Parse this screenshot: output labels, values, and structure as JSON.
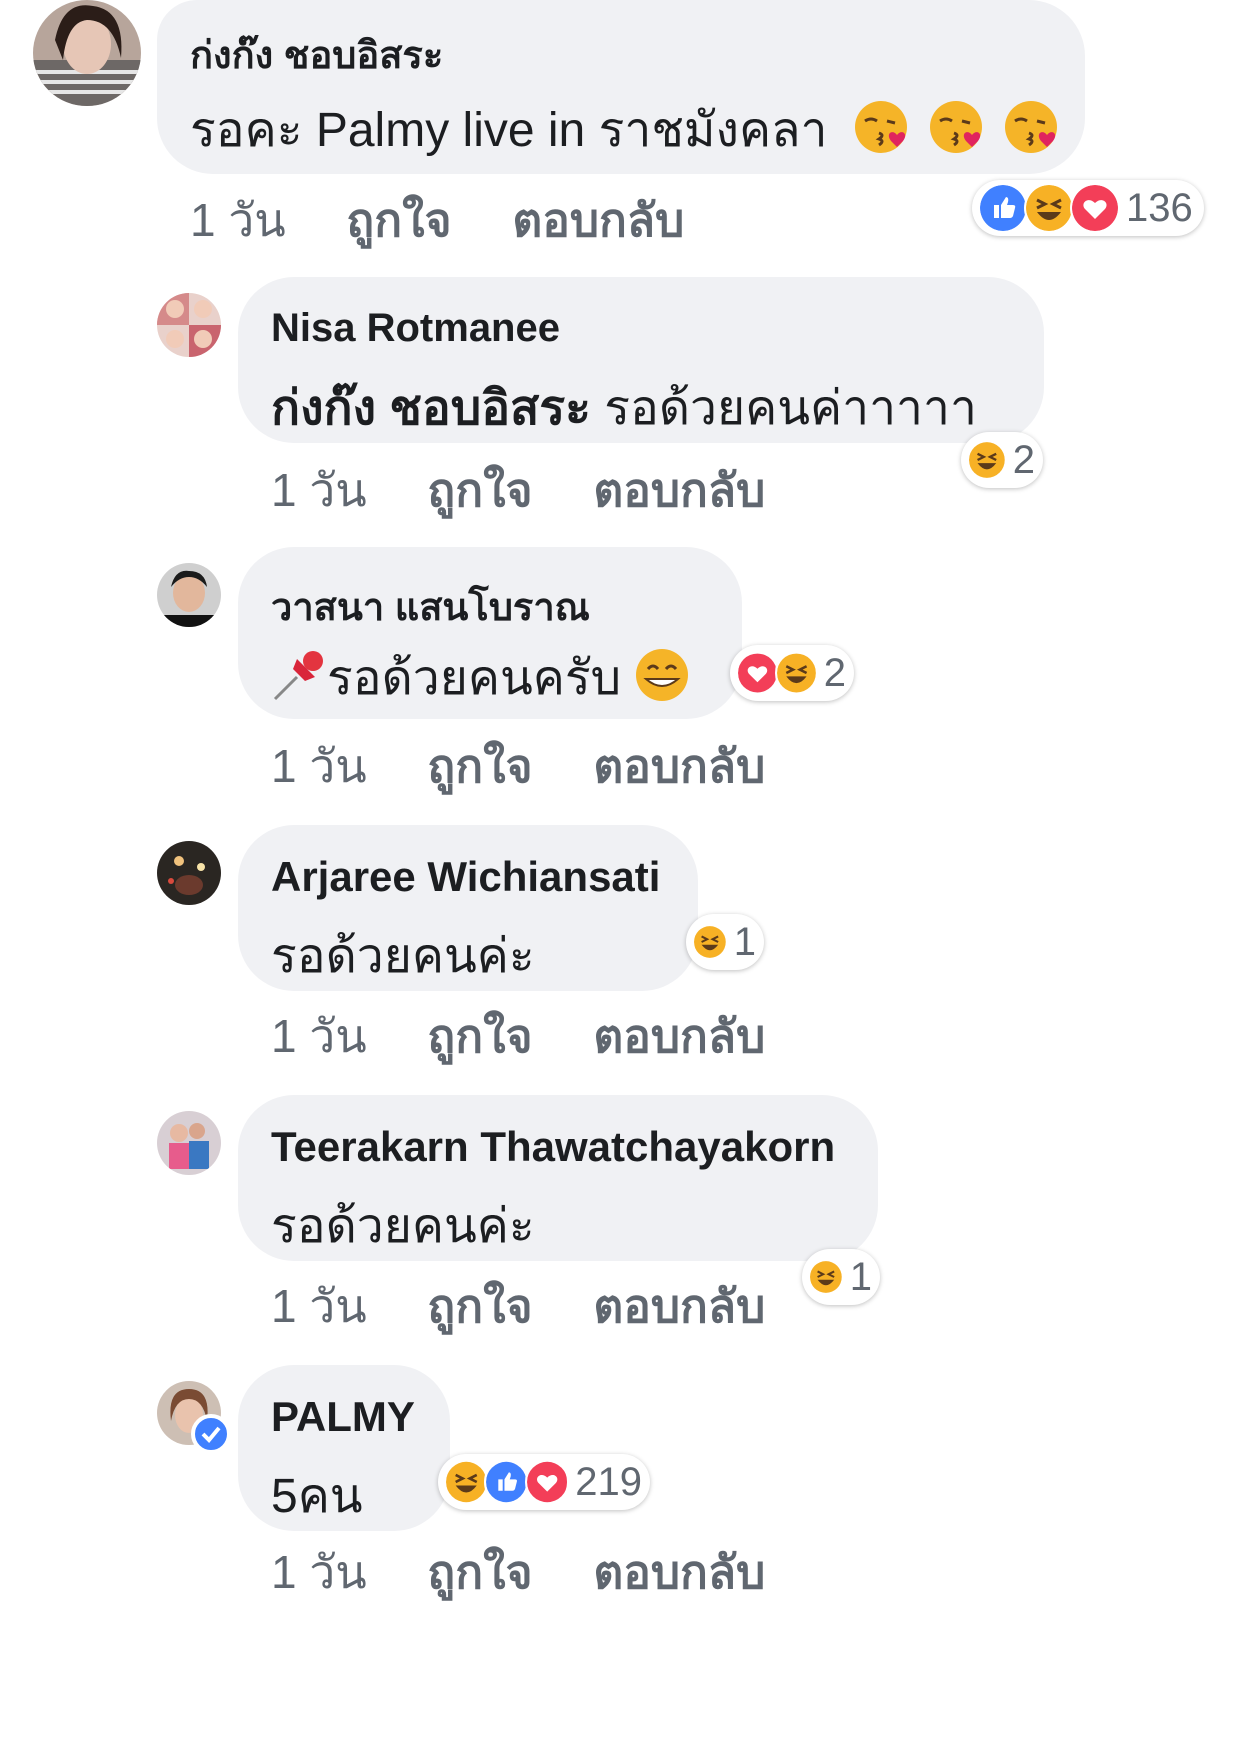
{
  "comments": [
    {
      "author": "ก่งก๊ง ชอบอิสระ",
      "text": "รอคะ Palmy live in ราชมังคลา",
      "emoji_after_text": [
        "kissing-heart",
        "kissing-heart",
        "kissing-heart"
      ],
      "time": "1 วัน",
      "like": "ถูกใจ",
      "reply": "ตอบกลับ",
      "reactions": [
        "like",
        "haha",
        "love"
      ],
      "reaction_count": "136"
    },
    {
      "author": "Nisa Rotmanee",
      "mention": "ก่งก๊ง ชอบอิสระ",
      "text": " รอด้วยคนค่าาาาา",
      "time": "1 วัน",
      "like": "ถูกใจ",
      "reply": "ตอบกลับ",
      "reactions": [
        "haha"
      ],
      "reaction_count": "2"
    },
    {
      "author": "วาสนา แสนโบราณ",
      "emoji_before_text": "pushpin",
      "text": "รอด้วยคนครับ",
      "emoji_after_text": [
        "grinning-face"
      ],
      "time": "1 วัน",
      "like": "ถูกใจ",
      "reply": "ตอบกลับ",
      "reactions": [
        "love",
        "haha"
      ],
      "reaction_count": "2"
    },
    {
      "author": "Arjaree Wichiansati",
      "text": "รอด้วยคนค่ะ",
      "time": "1 วัน",
      "like": "ถูกใจ",
      "reply": "ตอบกลับ",
      "reactions": [
        "haha"
      ],
      "reaction_count": "1"
    },
    {
      "author": "Teerakarn Thawatchayakorn",
      "text": "รอด้วยคนค่ะ",
      "time": "1 วัน",
      "like": "ถูกใจ",
      "reply": "ตอบกลับ",
      "reactions": [
        "haha"
      ],
      "reaction_count": "1"
    },
    {
      "author": "PALMY",
      "verified": true,
      "text": "5คน",
      "time": "1 วัน",
      "like": "ถูกใจ",
      "reply": "ตอบกลับ",
      "reactions": [
        "haha",
        "like",
        "love"
      ],
      "reaction_count": "219"
    }
  ],
  "colors": {
    "bubble": "#f0f1f4",
    "meta_text": "#606770",
    "like_blue": "#4080ff",
    "love_red": "#f33e58",
    "haha_yellow": "#f7b125"
  }
}
